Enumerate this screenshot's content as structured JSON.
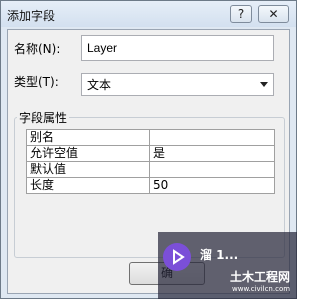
{
  "window": {
    "title": "添加字段",
    "help_label": "?",
    "close_label": "✕"
  },
  "form": {
    "name_label": "名称(N):",
    "name_value": "Layer",
    "type_label": "类型(T):",
    "type_value": "文本"
  },
  "properties": {
    "group_label": "字段属性",
    "rows": [
      {
        "key": "别名",
        "value": ""
      },
      {
        "key": "允许空值",
        "value": "是"
      },
      {
        "key": "默认值",
        "value": ""
      },
      {
        "key": "长度",
        "value": "50"
      }
    ]
  },
  "buttons": {
    "ok_label": "确"
  },
  "watermark": {
    "text": "土木工程网",
    "subtext": "www.civilcn.com",
    "overlay_text": "溜 1..."
  }
}
